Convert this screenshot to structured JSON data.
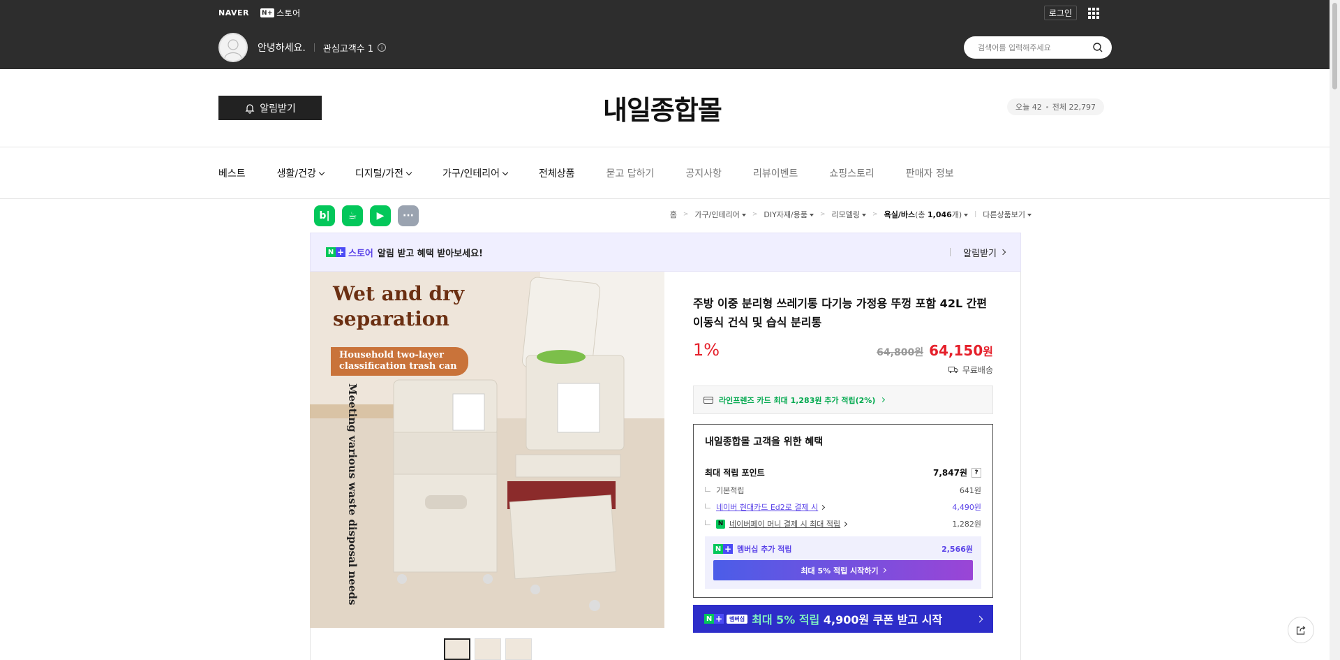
{
  "top": {
    "naver_logo": "NAVER",
    "nplus_mark": "N+",
    "store_label": "스토어",
    "login_label": "로그인",
    "greeting": "안녕하세요.",
    "follower_label": "관심고객수 1",
    "info_glyph": "i",
    "search_placeholder": "검색어를 입력해주세요"
  },
  "header": {
    "alarm_label": "알림받기",
    "store_title": "내일종합몰",
    "visitors_today": "오늘 42",
    "visitors_total": "전체 22,797"
  },
  "nav": {
    "items": [
      {
        "label": "베스트"
      },
      {
        "label": "생활/건강"
      },
      {
        "label": "디지털/가전"
      },
      {
        "label": "가구/인테리어"
      },
      {
        "label": "전체상품"
      },
      {
        "label": "묻고 답하기"
      },
      {
        "label": "공지사항"
      },
      {
        "label": "리뷰이벤트"
      },
      {
        "label": "쇼핑스토리"
      },
      {
        "label": "판매자 정보"
      }
    ]
  },
  "shortcuts": [
    {
      "glyph": "b|",
      "icon": "blog-icon",
      "color": "#03c75a"
    },
    {
      "glyph": "☕",
      "icon": "cafe-icon",
      "color": "#03c75a"
    },
    {
      "glyph": "▶",
      "icon": "bookmark-icon",
      "color": "#03c75a"
    },
    {
      "glyph": "···",
      "icon": "more-icon",
      "color": "#9aa3b0"
    }
  ],
  "breadcrumb": {
    "home": "홈",
    "c1": "가구/인테리어",
    "c2": "DIY자재/용품",
    "c3": "리모델링",
    "c4": "욕실/바스",
    "c4_count_prefix": "(총 ",
    "c4_count": "1,046",
    "c4_count_suffix": "개)",
    "other": "다른상품보기"
  },
  "banner": {
    "brand": "스토어",
    "message": "알림 받고 혜택 받아보세요!",
    "action": "알림받기"
  },
  "image": {
    "title_line1": "Wet and dry",
    "title_line2": "separation",
    "pill_line1": "Household two-layer",
    "pill_line2": "classification trash can",
    "vertical_text": "Meeting various waste disposal needs"
  },
  "product": {
    "name": "주방 이중 분리형 쓰레기통 다기능 가정용 뚜껑 포함 42L 간편 이동식 건식 및 습식 분리통",
    "discount": "1%",
    "original_price": "64,800원",
    "sale_price_num": "64,150",
    "sale_price_unit": "원",
    "shipping": "무료배송",
    "card_benefit": "라인프렌즈 카드 최대 1,283원 추가 적립(2%)",
    "benefit_title": "내일종합몰 고객을 위한 혜택",
    "max_point_label": "최대 적립 포인트",
    "max_point_value": "7,847원",
    "help_glyph": "?",
    "base_label": "기본적립",
    "base_value": "641원",
    "hyundai_label": "네이버 현대카드 Ed2로 결제 시",
    "hyundai_value": "4,490원",
    "npay_icon_glyph": "N",
    "npay_label": "네이버페이 머니 결제 시 최대 적립",
    "npay_value": "1,282원",
    "membership_label": "멤버십 추가 적립",
    "membership_value": "2,566원",
    "membership_button": "최대 5% 적립 시작하기",
    "coupon_tag": "멤버십",
    "coupon_prefix": "최대 5% 적립",
    "coupon_rest": " 4,900원 쿠폰 받고 시작"
  },
  "colors": {
    "dark_header": "#2d2d2d",
    "naver_green": "#03c75a",
    "price_red": "#e5202b",
    "plus_purple": "#5a43e8",
    "coupon_blue": "#2d2dc9"
  }
}
